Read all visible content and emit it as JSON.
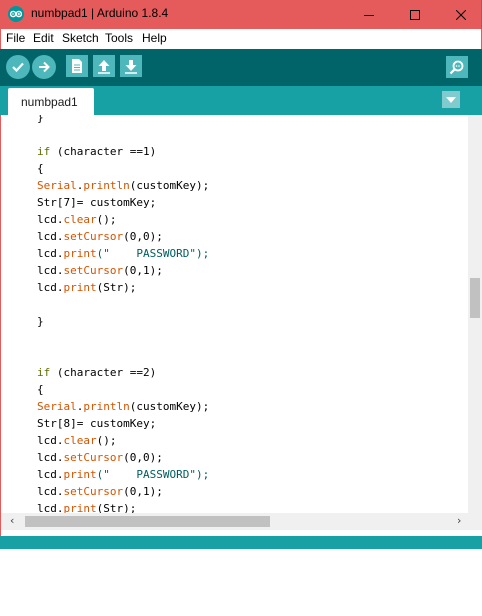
{
  "titlebar": {
    "title": "numbpad1 | Arduino 1.8.4",
    "bg_color": "#e55b5b",
    "icon": "arduino-logo-icon"
  },
  "menu": {
    "items": [
      "File",
      "Edit",
      "Sketch",
      "Tools",
      "Help"
    ]
  },
  "toolbar": {
    "buttons": [
      "verify-icon",
      "upload-icon",
      "new-icon",
      "open-icon",
      "save-icon",
      "serial-monitor-icon"
    ]
  },
  "tabs": {
    "active": "numbpad1"
  },
  "colors": {
    "toolbar": "#006468",
    "tabstrip": "#17a1a5",
    "keyword": "#5e6d03",
    "function": "#d35400",
    "string": "#005c5f"
  },
  "code": {
    "lines": [
      [
        {
          "t": "}",
          "c": ""
        }
      ],
      [
        {
          "t": "",
          "c": ""
        }
      ],
      [
        {
          "t": "if",
          "c": "kw"
        },
        {
          "t": " (character ==1)",
          "c": ""
        }
      ],
      [
        {
          "t": "{",
          "c": ""
        }
      ],
      [
        {
          "t": "Serial",
          "c": "cls"
        },
        {
          "t": ".",
          "c": ""
        },
        {
          "t": "println",
          "c": "fn"
        },
        {
          "t": "(customKey);",
          "c": ""
        }
      ],
      [
        {
          "t": "Str[7]= customKey;",
          "c": ""
        }
      ],
      [
        {
          "t": "lcd.",
          "c": ""
        },
        {
          "t": "clear",
          "c": "fn"
        },
        {
          "t": "();",
          "c": ""
        }
      ],
      [
        {
          "t": "lcd.",
          "c": ""
        },
        {
          "t": "setCursor",
          "c": "fn"
        },
        {
          "t": "(0,0);",
          "c": ""
        }
      ],
      [
        {
          "t": "lcd.",
          "c": ""
        },
        {
          "t": "print",
          "c": "fn"
        },
        {
          "t": "(\"    PASSWORD\");",
          "c": "str"
        }
      ],
      [
        {
          "t": "lcd.",
          "c": ""
        },
        {
          "t": "setCursor",
          "c": "fn"
        },
        {
          "t": "(0,1);",
          "c": ""
        }
      ],
      [
        {
          "t": "lcd.",
          "c": ""
        },
        {
          "t": "print",
          "c": "fn"
        },
        {
          "t": "(Str);",
          "c": ""
        }
      ],
      [
        {
          "t": "",
          "c": ""
        }
      ],
      [
        {
          "t": "}",
          "c": ""
        }
      ],
      [
        {
          "t": "",
          "c": ""
        }
      ],
      [
        {
          "t": "",
          "c": ""
        }
      ],
      [
        {
          "t": "if",
          "c": "kw"
        },
        {
          "t": " (character ==2)",
          "c": ""
        }
      ],
      [
        {
          "t": "{",
          "c": ""
        }
      ],
      [
        {
          "t": "Serial",
          "c": "cls"
        },
        {
          "t": ".",
          "c": ""
        },
        {
          "t": "println",
          "c": "fn"
        },
        {
          "t": "(customKey);",
          "c": ""
        }
      ],
      [
        {
          "t": "Str[8]= customKey;",
          "c": ""
        }
      ],
      [
        {
          "t": "lcd.",
          "c": ""
        },
        {
          "t": "clear",
          "c": "fn"
        },
        {
          "t": "();",
          "c": ""
        }
      ],
      [
        {
          "t": "lcd.",
          "c": ""
        },
        {
          "t": "setCursor",
          "c": "fn"
        },
        {
          "t": "(0,0);",
          "c": ""
        }
      ],
      [
        {
          "t": "lcd.",
          "c": ""
        },
        {
          "t": "print",
          "c": "fn"
        },
        {
          "t": "(\"    PASSWORD\");",
          "c": "str"
        }
      ],
      [
        {
          "t": "lcd.",
          "c": ""
        },
        {
          "t": "setCursor",
          "c": "fn"
        },
        {
          "t": "(0,1);",
          "c": ""
        }
      ],
      [
        {
          "t": "lcd.",
          "c": ""
        },
        {
          "t": "print",
          "c": "fn"
        },
        {
          "t": "(Str);",
          "c": ""
        }
      ]
    ]
  }
}
